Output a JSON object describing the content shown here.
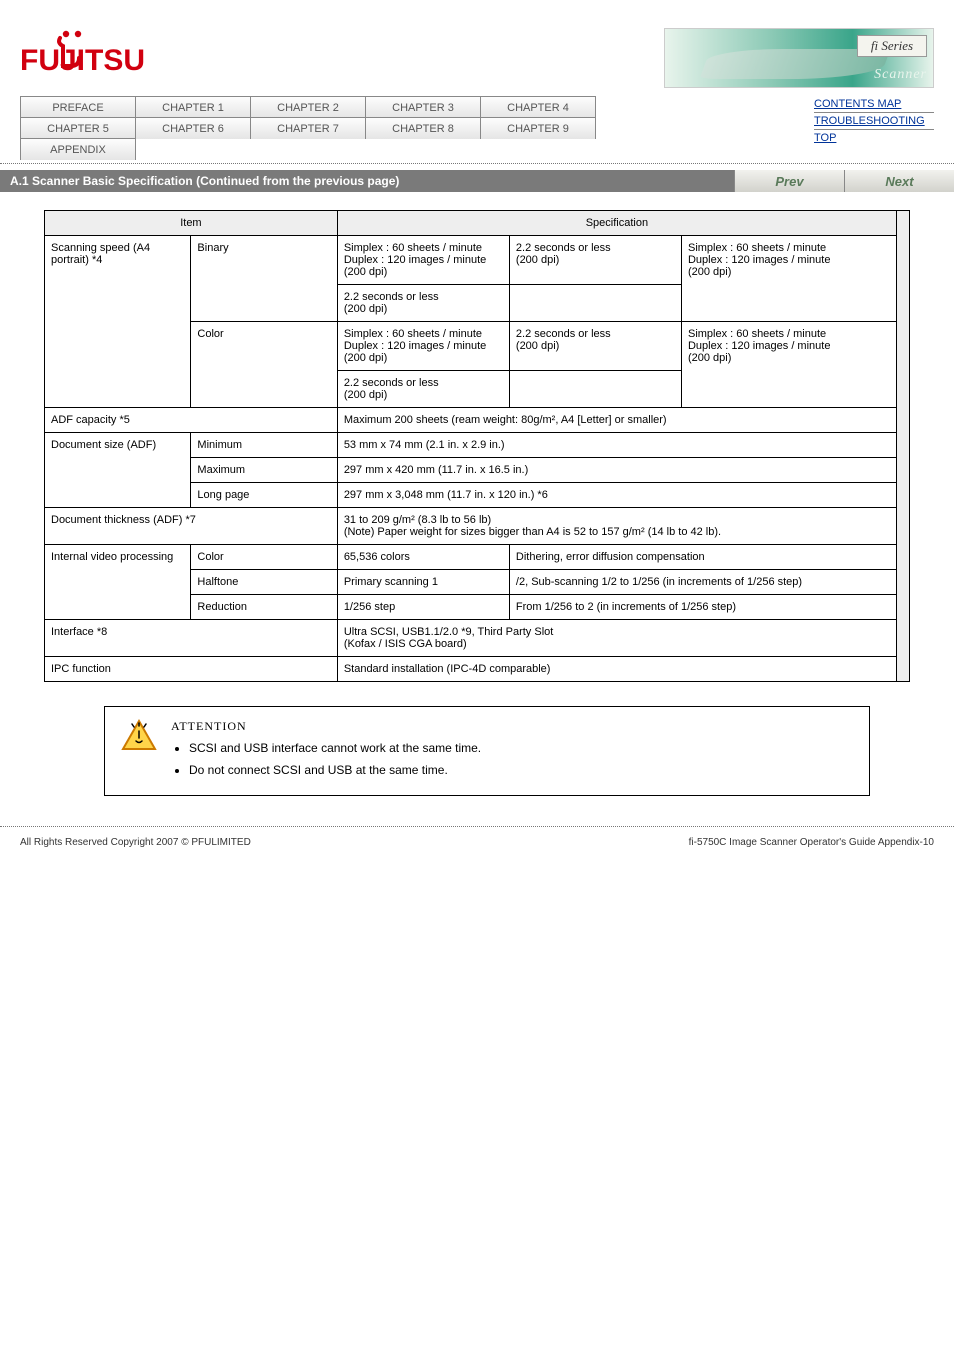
{
  "header": {
    "logo_text": "FUJITSU",
    "fi_box": "fi Series",
    "fi_scanner": "Scanner"
  },
  "tabs": {
    "items": [
      {
        "label": "PREFACE"
      },
      {
        "label": "CHAPTER 1"
      },
      {
        "label": "CHAPTER 2"
      },
      {
        "label": "CHAPTER 3"
      },
      {
        "label": "CHAPTER 4"
      },
      {
        "label": "CHAPTER 5"
      },
      {
        "label": "CHAPTER 6"
      },
      {
        "label": "CHAPTER 7"
      },
      {
        "label": "CHAPTER 8"
      },
      {
        "label": "CHAPTER 9"
      },
      {
        "label": "APPENDIX"
      }
    ]
  },
  "sidelinks": {
    "items": [
      {
        "label": "CONTENTS MAP"
      },
      {
        "label": "TROUBLESHOOTING"
      },
      {
        "label": "TOP"
      }
    ]
  },
  "titlebar": {
    "title": "A.1 Scanner Basic Specification (Continued from the previous page)",
    "prev": "Prev",
    "next": "Next"
  },
  "table": {
    "header": {
      "item": "Item",
      "spec": "Specification"
    },
    "rows": [
      {
        "cat": "Scanning speed (A4 portrait) *4",
        "sub": "Binary",
        "adf": "Simplex : 60 sheets / minute\nDuplex  : 120 images / minute\n(200 dpi)",
        "flatbed_binary": "2.2 seconds or less\n(200 dpi)",
        "adf2": "Simplex : 60 sheets / minute\nDuplex  : 120 images / minute\n(200 dpi)",
        "flatbed2": "2.2 seconds or less\n(200 dpi)"
      },
      {
        "sub": "Color",
        "adf": "Simplex : 60 sheets / minute\nDuplex  : 120 images / minute\n(200 dpi)",
        "flatbed": "2.2 seconds or less\n(200 dpi)",
        "adf2": "Simplex : 60 sheets / minute\nDuplex  : 120 images / minute\n(200 dpi)",
        "flatbed2": "2.2 seconds or less\n(200 dpi)"
      },
      {
        "cat": "ADF capacity *5",
        "val": "Maximum 200 sheets (ream weight: 80g/m², A4 [Letter] or smaller)"
      },
      {
        "cat": "Document size (ADF)",
        "sub1": {
          "label": "Minimum",
          "val": "53 mm x 74 mm (2.1 in. x 2.9 in.)"
        },
        "sub2": {
          "label": "Maximum",
          "val": "297 mm x 420 mm (11.7 in. x 16.5 in.)"
        },
        "sub3": {
          "label": "Long page",
          "val": "297 mm x 3,048 mm (11.7 in. x 120 in.) *6"
        }
      },
      {
        "cat": "Document thickness (ADF) *7",
        "val": "31 to 209 g/m² (8.3 lb to 56 lb)\n(Note) Paper weight for sizes bigger than A4 is 52 to 157 g/m² (14 lb to 42 lb)."
      },
      {
        "cat": "Internal video processing",
        "sub1": {
          "label": "Color",
          "val": "65,536 colors",
          "val2": "Dithering, error diffusion compensation"
        },
        "sub2": {
          "label": "Halftone",
          "val": "Primary scanning 1",
          "val2": "/2, Sub-scanning 1/2 to 1/256 (in increments of 1/256 step)"
        },
        "sub3": {
          "label": "Reduction",
          "val": "1/256 step",
          "val2": "From 1/256  to 2 (in increments of 1/256 step)"
        }
      },
      {
        "cat": "Interface *8",
        "val": "Ultra SCSI, USB1.1/2.0 *9, Third Party Slot\n(Kofax / ISIS CGA board)"
      },
      {
        "cat": "IPC function",
        "val": "Standard installation (IPC-4D comparable)"
      }
    ]
  },
  "note": {
    "heading": "ATTENTION",
    "lines": [
      "SCSI and USB interface cannot work at the same time.",
      "Do not connect SCSI and USB at the same time."
    ]
  },
  "footer": {
    "left": "All Rights Reserved Copyright 2007 © PFULIMITED",
    "right": "fi-5750C Image Scanner Operator's Guide Appendix-10"
  }
}
